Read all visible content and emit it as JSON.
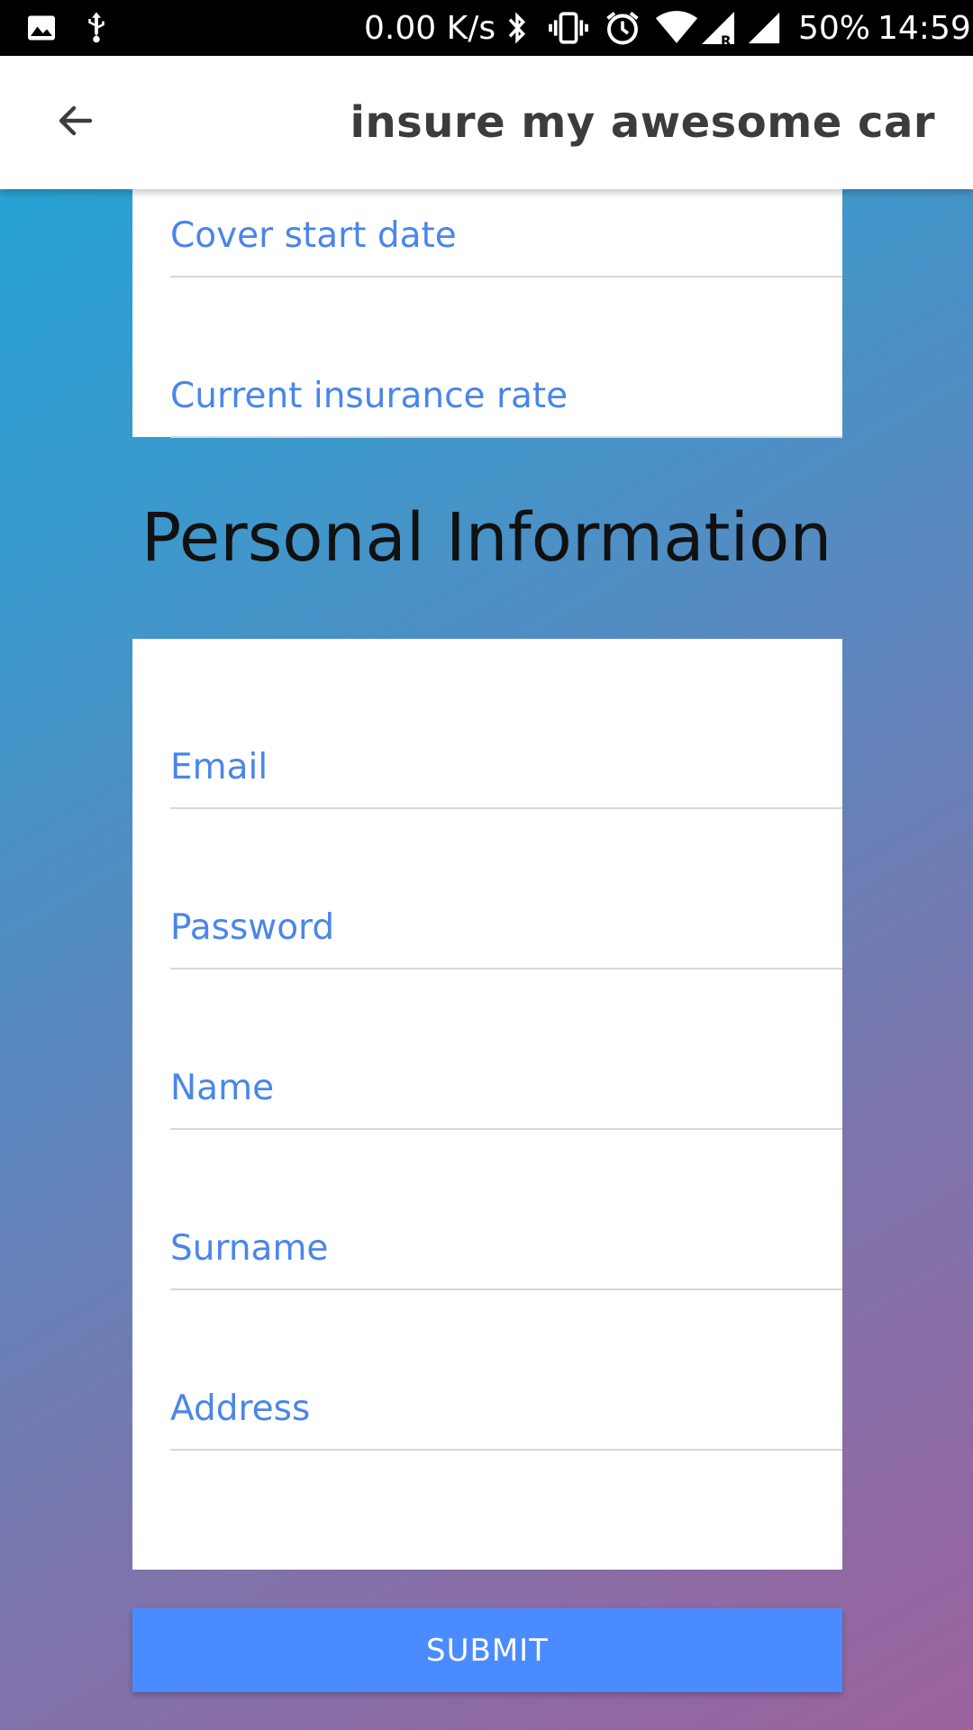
{
  "status_bar": {
    "network_speed": "0.00 K/s",
    "battery": "50%",
    "time": "14:59",
    "icons": [
      "image-icon",
      "usb-icon",
      "bluetooth-icon",
      "vibrate-icon",
      "alarm-icon",
      "wifi-icon",
      "signal-roaming-icon",
      "signal-icon"
    ]
  },
  "app_bar": {
    "back_icon": "arrow-left-icon",
    "title": "insure my awesome car"
  },
  "insurance_card": {
    "fields": [
      {
        "label": "Cover start date"
      },
      {
        "label": "Current insurance rate"
      }
    ]
  },
  "personal_section": {
    "title": "Personal Information",
    "fields": [
      {
        "label": "Email"
      },
      {
        "label": "Password"
      },
      {
        "label": "Name"
      },
      {
        "label": "Surname"
      },
      {
        "label": "Address"
      }
    ]
  },
  "submit_button": {
    "label": "SUBMIT"
  },
  "colors": {
    "accent": "#4a86e8",
    "button": "#4a8cff",
    "gradient_start": "#1ea6d6",
    "gradient_end": "#9c629e"
  }
}
